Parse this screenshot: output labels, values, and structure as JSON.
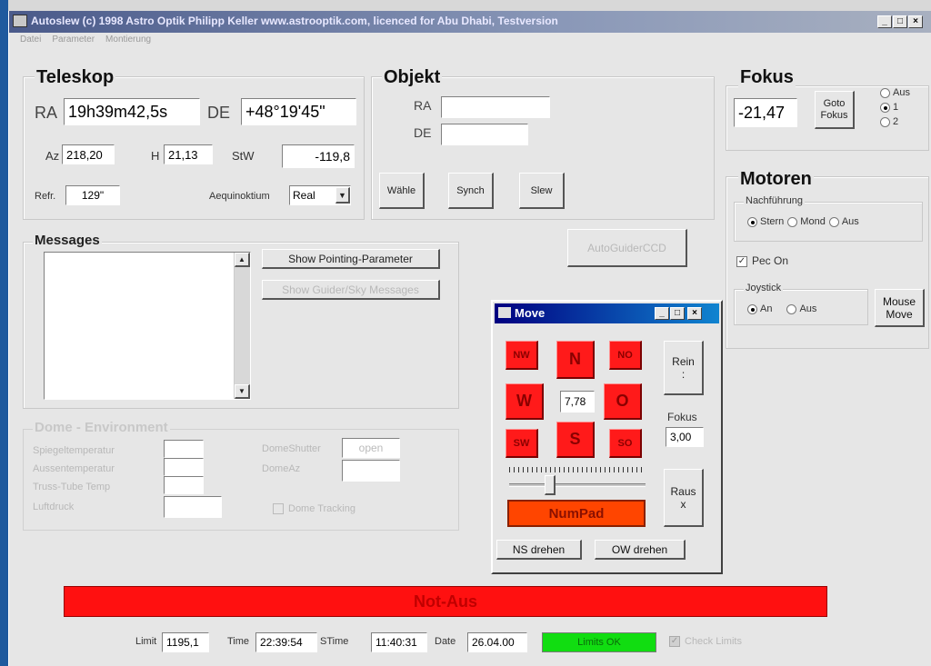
{
  "window": {
    "title": "Autoslew (c) 1998 Astro Optik Philipp Keller www.astrooptik.com, licenced for Abu Dhabi, Testversion",
    "menu": [
      "Datei",
      "Parameter",
      "Montierung"
    ]
  },
  "teleskop": {
    "title": "Teleskop",
    "ra_label": "RA",
    "ra_value": "19h39m42,5s",
    "de_label": "DE",
    "de_value": "+48°19'45\"",
    "az_label": "Az",
    "az_value": "218,20",
    "h_label": "H",
    "h_value": "21,13",
    "stw_label": "StW",
    "stw_value": "-119,8",
    "refr_label": "Refr.",
    "refr_value": "129\"",
    "aequinoktium_label": "Aequinoktium",
    "aequinoktium_value": "Real"
  },
  "objekt": {
    "title": "Objekt",
    "ra_label": "RA",
    "ra_value": "",
    "de_label": "DE",
    "de_value": "",
    "buttons": [
      "Wähle",
      "Synch",
      "Slew"
    ]
  },
  "fokus": {
    "title": "Fokus",
    "value": "-21,47",
    "goto_label": "Goto Fokus",
    "options": [
      "Aus",
      "1",
      "2"
    ],
    "selected": "1"
  },
  "motoren": {
    "title": "Motoren",
    "nachfuehrung_label": "Nachführung",
    "nachfuehrung_options": [
      "Stern",
      "Mond",
      "Aus"
    ],
    "nachfuehrung_selected": "Stern",
    "pec_label": "Pec On",
    "pec_checked": true,
    "joystick_label": "Joystick",
    "joystick_options": [
      "An",
      "Aus"
    ],
    "joystick_selected": "An",
    "mouse_move_label": "Mouse Move"
  },
  "messages": {
    "title": "Messages",
    "show_pointing_label": "Show Pointing-Parameter",
    "show_guider_label": "Show Guider/Sky Messages",
    "autoguider_label": "AutoGuiderCCD"
  },
  "dome": {
    "title": "Dome - Environment",
    "spiegeltemperatur_label": "Spiegeltemperatur",
    "aussentemperatur_label": "Aussentemperatur",
    "truss_label": "Truss-Tube Temp",
    "luftdruck_label": "Luftdruck",
    "shutter_label": "DomeShutter",
    "shutter_value": "open",
    "domeaz_label": "DomeAz",
    "tracking_label": "Dome Tracking"
  },
  "move_window": {
    "title": "Move",
    "buttons": {
      "nw": "NW",
      "n": "N",
      "no": "NO",
      "w": "W",
      "o": "O",
      "sw": "SW",
      "s": "S",
      "so": "SO"
    },
    "speed_value": "7,78",
    "rein_label": "Rein",
    "rein_sub": ":",
    "fokus_label": "Fokus",
    "fokus_value": "3,00",
    "raus_label": "Raus",
    "raus_sub": "x",
    "slider_value": 0.28,
    "numpad_label": "NumPad",
    "ns_label": "NS drehen",
    "ow_label": "OW drehen"
  },
  "not_aus_label": "Not-Aus",
  "status": {
    "limit_label": "Limit",
    "limit_value": "1195,1",
    "time_label": "Time",
    "time_value": "22:39:54",
    "stime_label": "STime",
    "stime_value": "11:40:31",
    "date_label": "Date",
    "date_value": "26.04.00",
    "limits_ok": "Limits OK",
    "check_limits_label": "Check Limits"
  },
  "colors": {
    "title_bar_start": "#000080",
    "title_bar_end": "#1084d0",
    "red_button": "#ff1a1a",
    "not_aus": "#ff1010",
    "numpad": "#ff4500",
    "limits_ok": "#11dd11"
  }
}
